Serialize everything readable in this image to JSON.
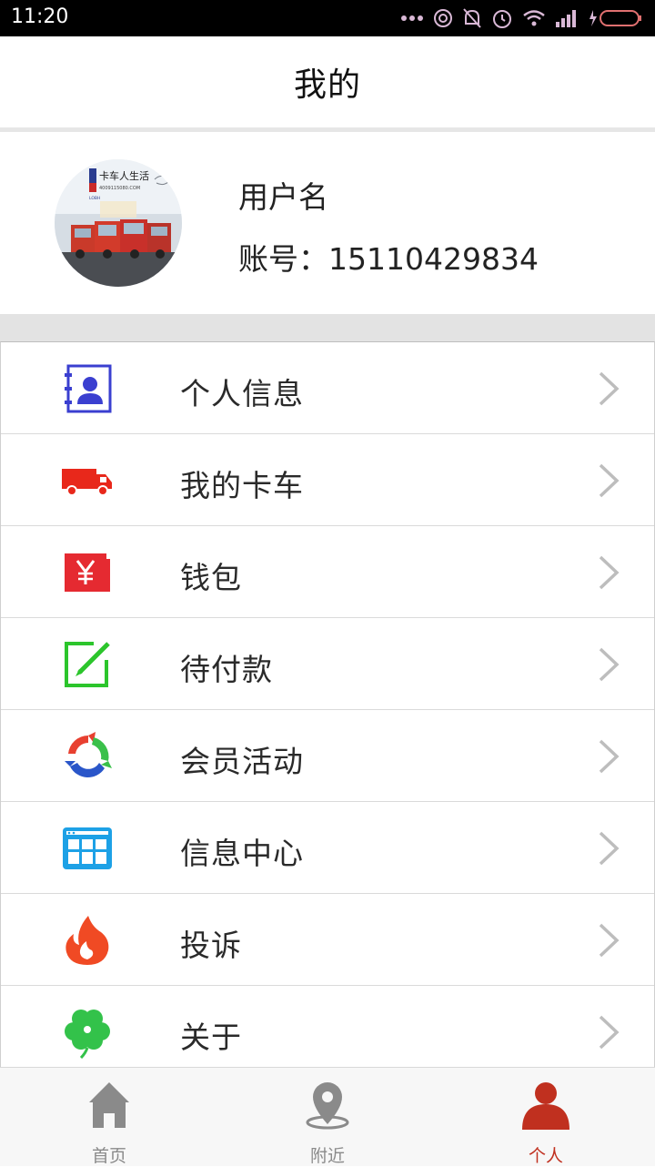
{
  "status_bar": {
    "time": "11:20"
  },
  "header": {
    "title": "我的"
  },
  "profile": {
    "avatar_text_top": "卡车人生活",
    "avatar_text_sub": "4009115080.COM",
    "avatar_badge": "LOBH",
    "username": "用户名",
    "account": "账号：15110429834"
  },
  "menu": {
    "items": [
      {
        "label": "个人信息",
        "icon": "contact-card-icon",
        "color": "#3a3fd0"
      },
      {
        "label": "我的卡车",
        "icon": "truck-icon",
        "color": "#e8281b"
      },
      {
        "label": "钱包",
        "icon": "wallet-yen-icon",
        "color": "#e52a31"
      },
      {
        "label": "待付款",
        "icon": "edit-note-icon",
        "color": "#2cc52c"
      },
      {
        "label": "会员活动",
        "icon": "refresh-cycle-icon",
        "color": "#2a56c9"
      },
      {
        "label": "信息中心",
        "icon": "grid-panel-icon",
        "color": "#1da1e6"
      },
      {
        "label": "投诉",
        "icon": "flame-icon",
        "color": "#f04a24"
      },
      {
        "label": "关于",
        "icon": "clover-icon",
        "color": "#33c24a"
      }
    ]
  },
  "tabs": [
    {
      "label": "首页",
      "icon": "home-icon",
      "active": false
    },
    {
      "label": "附近",
      "icon": "location-pin-icon",
      "active": false
    },
    {
      "label": "个人",
      "icon": "person-icon",
      "active": true
    }
  ],
  "colors": {
    "accent": "#c0301f",
    "inactive": "#8a8a8a"
  }
}
